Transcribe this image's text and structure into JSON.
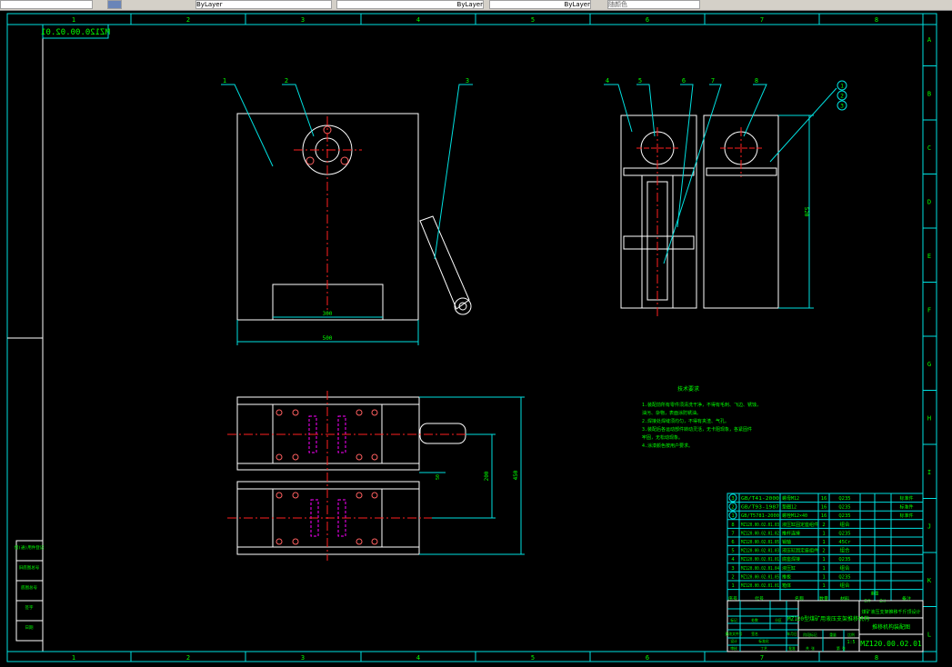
{
  "toolbar": {
    "fields": [
      "",
      "ByLayer",
      "ByLayer",
      "ByLayer",
      "随颜色"
    ]
  },
  "border": {
    "columns": [
      "1",
      "2",
      "3",
      "4",
      "5",
      "6",
      "7",
      "8"
    ],
    "rows": [
      "A",
      "B",
      "C",
      "D",
      "E",
      "F",
      "G",
      "H",
      "I",
      "J",
      "K",
      "L"
    ]
  },
  "drawing_number_mirrored": "MZ120.00.02.01",
  "balloons": [
    "1",
    "2",
    "3",
    "4",
    "5",
    "6",
    "7",
    "8"
  ],
  "circle_balloons": [
    "1",
    "2",
    "3"
  ],
  "dimensions": {
    "inner_width": "300",
    "outer_width": "500",
    "height_side": "520",
    "plan_height": "450",
    "plan_offset": "200",
    "small": "50"
  },
  "notes": {
    "title": "技术要求",
    "lines": [
      "1.装配前所有零件须清洗干净，不得有毛刺、飞边、锈蚀，",
      "  油污、杂物，表面涂防锈油。",
      "2.焊接处焊缝须均匀，不得有夹渣、气孔。",
      "3.装配后各运动部件转动灵活，无卡阻现象，各紧固件",
      "  牢固，无松动现象。",
      "4.涂漆颜色按用户要求。"
    ]
  },
  "parts": [
    {
      "no": "3",
      "code": "GB/T41-2000",
      "name": "螺母M12",
      "qty": "16",
      "material": "Q235",
      "note": "标准件",
      "circled": true
    },
    {
      "no": "2",
      "code": "GB/T93-1987",
      "name": "垫圈12",
      "qty": "16",
      "material": "Q235",
      "note": "标准件",
      "circled": true
    },
    {
      "no": "1",
      "code": "GB/T5781-2000",
      "name": "螺栓M12×40",
      "qty": "16",
      "material": "Q235",
      "note": "标准件",
      "circled": true
    },
    {
      "no": "8",
      "code": "MZ120.00.02.01.03",
      "name": "液压缸固定座组件",
      "qty": "2",
      "material": "组合",
      "note": ""
    },
    {
      "no": "7",
      "code": "MZ120.00.02.01.02",
      "name": "推杆连接",
      "qty": "1",
      "material": "Q235",
      "note": ""
    },
    {
      "no": "6",
      "code": "MZ120.00.02.01.05",
      "name": "销轴",
      "qty": "1",
      "material": "45Cr",
      "note": ""
    },
    {
      "no": "5",
      "code": "MZ120.00.02.01.03",
      "name": "液压缸固定座组件",
      "qty": "2",
      "material": "组合",
      "note": ""
    },
    {
      "no": "4",
      "code": "MZ120.00.02.01.01",
      "name": "底座焊接",
      "qty": "1",
      "material": "Q235",
      "note": ""
    },
    {
      "no": "3",
      "code": "MZ120.00.02.01.04",
      "name": "液压缸",
      "qty": "1",
      "material": "组合",
      "note": ""
    },
    {
      "no": "2",
      "code": "MZ120.00.02.01.05",
      "name": "推板",
      "qty": "1",
      "material": "Q235",
      "note": ""
    },
    {
      "no": "1",
      "code": "MZ120.00.02.01.01",
      "name": "箱体",
      "qty": "1",
      "material": "组合",
      "note": ""
    }
  ],
  "parts_header": {
    "no": "序号",
    "code": "代号",
    "name": "名称",
    "qty": "数量",
    "material": "材料",
    "weight1": "单件",
    "weight2": "总计",
    "weight": "重量",
    "note": "备注"
  },
  "title_block": {
    "product": "MZ120型煤矿用液压支架推移机构",
    "school": "煤矿液压支架推移千斤顶设计",
    "drawing_name": "推移机构装配图",
    "drawing_number": "MZ120.00.02.01",
    "scale": "1:5",
    "labels": [
      "标记",
      "处数",
      "分区",
      "更改文件号",
      "签名",
      "年月日",
      "设计",
      "标准化",
      "审核",
      "工艺",
      "批准",
      "阶段标记",
      "重量",
      "比例",
      "共 张",
      "第 张"
    ]
  },
  "left_labels": [
    "借(通)用件登记",
    "旧底图总号",
    "底图总号",
    "签字",
    "日期"
  ]
}
